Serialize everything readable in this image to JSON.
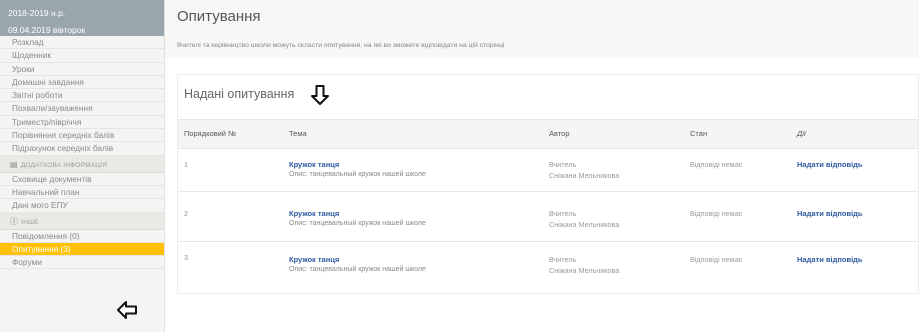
{
  "sidebar": {
    "year": "2018-2019 н.р.",
    "date": "09.04.2019 вівторок",
    "items_top": [
      "Розклад",
      "Щоденник",
      "Уроки",
      "Домашні завдання",
      "Звітні роботи",
      "Похвали/зауваження",
      "Триместр/півріччя",
      "Порівняння середніх балів",
      "Підрахунок середніх балів"
    ],
    "section_info": "ДОДАТКОВА ІНФОРМАЦІЯ",
    "items_info": [
      "Сховище документів",
      "Навчальний план",
      "Дані мого ЕПУ"
    ],
    "section_misc": "ІНШЕ",
    "items_misc": [
      "Повідомлення (0)",
      "Опитування (3)",
      "Форуми"
    ]
  },
  "page": {
    "title": "Опитування",
    "description": "Вчителі та керівництво школи можуть скласти опитування, на які ви зможете відповідати на цій сторінці"
  },
  "card": {
    "title": "Надані опитування",
    "columns": [
      "Порядковий №",
      "Тема",
      "Автор",
      "Стан",
      "Дії"
    ],
    "rows": [
      {
        "num": "1",
        "topic": "Кружок танця",
        "desc": "Опис: танцевальный кружок нашей школе",
        "author_role": "Вчитель",
        "author_name": "Сніжана Мельникова",
        "status": "Відповіді немає",
        "action": "Надати відповідь"
      },
      {
        "num": "2",
        "topic": "Кружок танця",
        "desc": "Опис: танцевальный кружок нашей школе",
        "author_role": "Вчитель",
        "author_name": "Сніжана Мельникова",
        "status": "Відповіді немає",
        "action": "Надати відповідь"
      },
      {
        "num": "3",
        "topic": "Кружок танця",
        "desc": "Опис: танцевальный кружок нашей школе",
        "author_role": "Вчитель",
        "author_name": "Сніжана Мельникова",
        "status": "Відповіді немає",
        "action": "Надати відповідь"
      }
    ]
  },
  "icons": {
    "info_section": "folder-icon",
    "misc_section": "info-circle-icon",
    "annotation_down": "arrow-down-outline-icon",
    "annotation_left": "arrow-left-outline-icon"
  },
  "colors": {
    "header_bar": "#9aa6ad",
    "active_item": "#ffc107",
    "link": "#2c5aa0"
  }
}
